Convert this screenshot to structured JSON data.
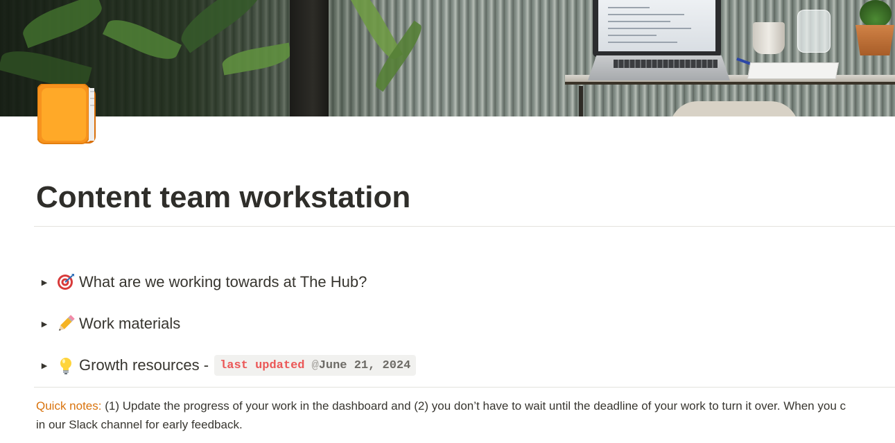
{
  "page": {
    "title": "Content team workstation"
  },
  "toggles": [
    {
      "emoji": "target-icon",
      "label": "What are we working towards at The Hub?"
    },
    {
      "emoji": "pencil-icon",
      "label": "Work materials"
    },
    {
      "emoji": "lightbulb-icon",
      "label": "Growth resources -",
      "code_red": "last updated",
      "code_at": "@",
      "code_date": "June 21, 2024"
    }
  ],
  "notes": {
    "label": "Quick notes:",
    "line1": "(1) Update the progress of your work in the dashboard and (2) you don’t have to wait until the deadline of your work to turn it over. When you c",
    "line2": "in our Slack channel for early feedback."
  },
  "colors": {
    "accent_orange": "#d9730d",
    "code_red": "#eb5757",
    "icon_orange": "#f7931e"
  }
}
